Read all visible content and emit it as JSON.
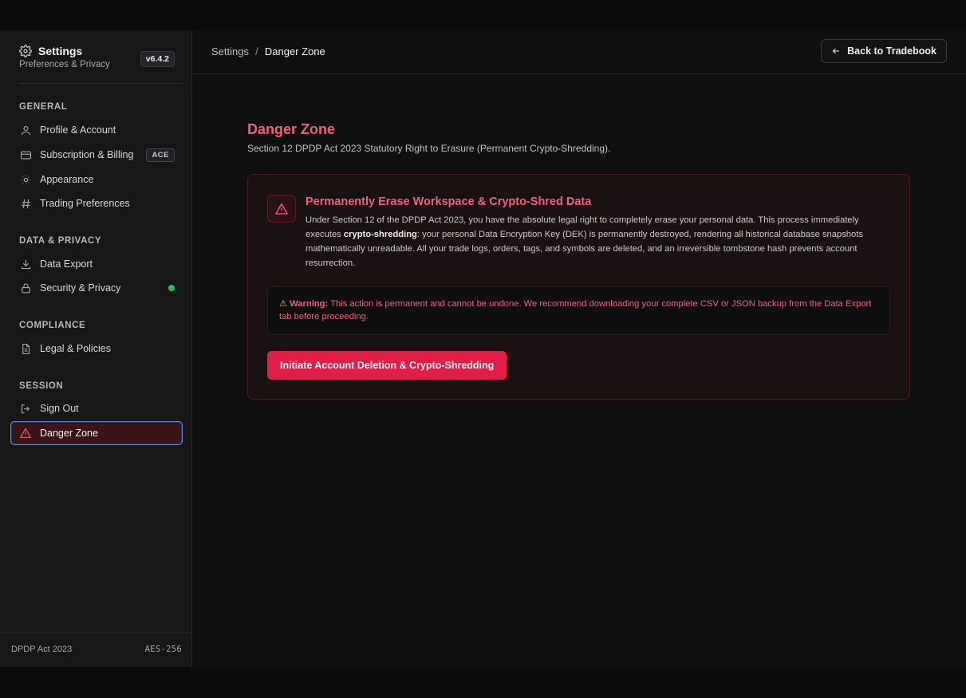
{
  "sidebar": {
    "title": "Settings",
    "subtitle": "Preferences & Privacy",
    "version": "v6.4.2",
    "sections": {
      "general": "GENERAL",
      "data_privacy": "DATA & PRIVACY",
      "compliance": "COMPLIANCE",
      "session": "SESSION"
    },
    "items": {
      "profile": "Profile & Account",
      "billing": "Subscription & Billing",
      "billing_badge": "ACE",
      "appearance": "Appearance",
      "trading": "Trading Preferences",
      "export": "Data Export",
      "security": "Security & Privacy",
      "legal": "Legal & Policies",
      "signout": "Sign Out",
      "danger": "Danger Zone"
    },
    "footer": {
      "left": "DPDP Act 2023",
      "right": "AES-256"
    },
    "status_color": "#22c55e"
  },
  "header": {
    "breadcrumb_root": "Settings",
    "breadcrumb_sep": "/",
    "breadcrumb_current": "Danger Zone",
    "back_label": "Back to Tradebook"
  },
  "page": {
    "title": "Danger Zone",
    "subtitle": "Section 12 DPDP Act 2023 Statutory Right to Erasure (Permanent Crypto-Shredding)."
  },
  "card": {
    "title": "Permanently Erase Workspace & Crypto-Shred Data",
    "body_part1": "Under Section 12 of the DPDP Act 2023, you have the absolute legal right to completely erase your personal data. This process immediately executes ",
    "body_bold": "crypto-shredding",
    "body_part2": ": your personal Data Encryption Key (DEK) is permanently destroyed, rendering all historical database snapshots mathematically unreadable. All your trade logs, orders, tags, and symbols are deleted, and an irreversible tombstone hash prevents account resurrection.",
    "warning_label": "Warning:",
    "warning_text": " This action is permanent and cannot be undone. We recommend downloading your complete CSV or JSON backup from the Data Export tab before proceeding.",
    "button_label": "Initiate Account Deletion & Crypto-Shredding"
  },
  "colors": {
    "accent_danger": "#f0607a",
    "danger_button": "#e11d48",
    "active_outline": "#5a8ce6"
  }
}
